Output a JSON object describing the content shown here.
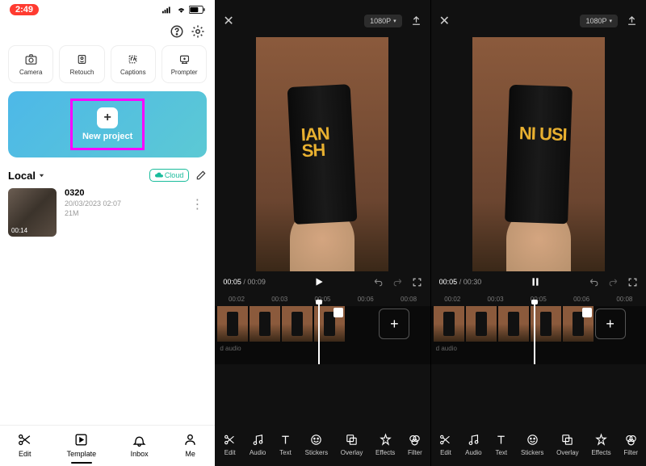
{
  "home": {
    "status": {
      "time": "2:49"
    },
    "tools": [
      {
        "name": "camera",
        "label": "Camera"
      },
      {
        "name": "retouch",
        "label": "Retouch"
      },
      {
        "name": "captions",
        "label": "Captions"
      },
      {
        "name": "prompter",
        "label": "Prompter"
      }
    ],
    "new_project_label": "New project",
    "local_title": "Local",
    "cloud_label": "Cloud",
    "project": {
      "name": "0320",
      "date": "20/03/2023 02:07",
      "size": "21M",
      "duration": "00:14"
    },
    "tabs": [
      {
        "name": "edit",
        "label": "Edit"
      },
      {
        "name": "template",
        "label": "Template"
      },
      {
        "name": "inbox",
        "label": "Inbox"
      },
      {
        "name": "me",
        "label": "Me"
      }
    ]
  },
  "editor": {
    "resolution": "1080P",
    "panel_a": {
      "current_time": "00:05",
      "total_time": "00:09",
      "play_state": "paused",
      "ruler": [
        "00:02",
        "00:03",
        "00:05",
        "00:06",
        "00:08"
      ]
    },
    "panel_b": {
      "current_time": "00:05",
      "total_time": "00:30",
      "play_state": "playing",
      "ruler": [
        "00:02",
        "00:03",
        "00:05",
        "00:06",
        "00:08"
      ]
    },
    "audio_track_label": "d audio",
    "cup_text_a": "IAN\nSH",
    "cup_text_b": "NI\nUSI",
    "tools": [
      {
        "name": "edit",
        "label": "Edit"
      },
      {
        "name": "audio",
        "label": "Audio"
      },
      {
        "name": "text",
        "label": "Text"
      },
      {
        "name": "stickers",
        "label": "Stickers"
      },
      {
        "name": "overlay",
        "label": "Overlay"
      },
      {
        "name": "effects",
        "label": "Effects"
      },
      {
        "name": "filter",
        "label": "Filter"
      }
    ]
  }
}
